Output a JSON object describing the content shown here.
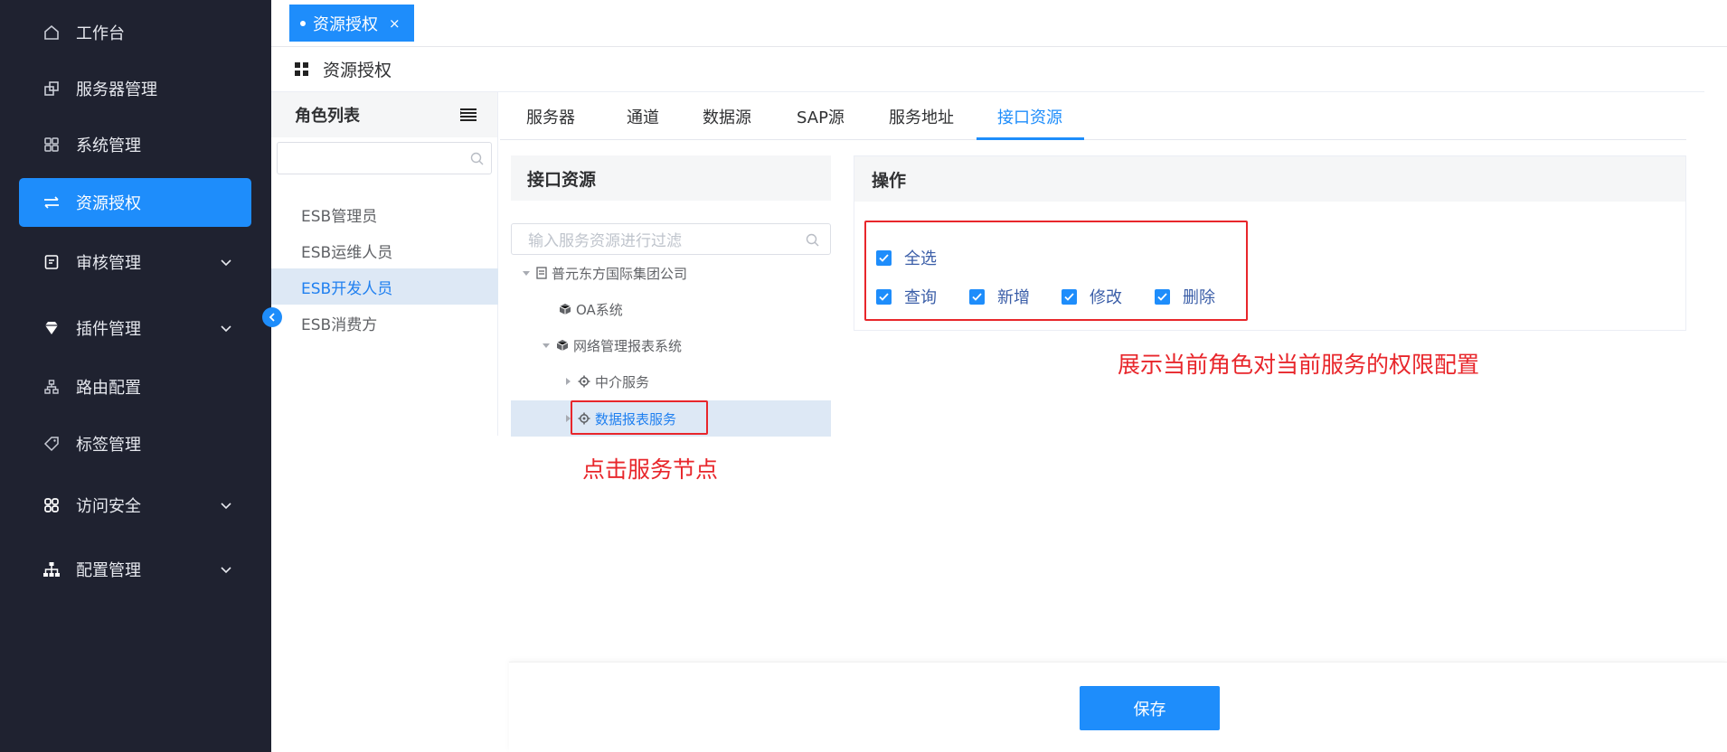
{
  "sidebar": {
    "items": [
      {
        "label": "工作台",
        "icon": "home-icon"
      },
      {
        "label": "服务器管理",
        "icon": "server-icon"
      },
      {
        "label": "系统管理",
        "icon": "grid-icon"
      },
      {
        "label": "资源授权",
        "icon": "swap-icon"
      },
      {
        "label": "审核管理",
        "icon": "audit-icon"
      },
      {
        "label": "插件管理",
        "icon": "diamond-icon"
      },
      {
        "label": "路由配置",
        "icon": "route-icon"
      },
      {
        "label": "标签管理",
        "icon": "tag-icon"
      },
      {
        "label": "访问安全",
        "icon": "security-icon"
      },
      {
        "label": "配置管理",
        "icon": "hierarchy-icon"
      }
    ]
  },
  "open_tab": {
    "label": "资源授权",
    "close": "×"
  },
  "breadcrumb": {
    "title": "资源授权"
  },
  "roles": {
    "title": "角色列表",
    "search_placeholder": "",
    "items": [
      "ESB管理员",
      "ESB运维人员",
      "ESB开发人员",
      "ESB消费方"
    ],
    "selected": "ESB开发人员"
  },
  "tabs": [
    "服务器",
    "通道",
    "数据源",
    "SAP源",
    "服务地址",
    "接口资源"
  ],
  "active_tab": "接口资源",
  "resource_panel": {
    "title": "接口资源",
    "filter_placeholder": "输入服务资源进行过滤",
    "tree": [
      {
        "label": "普元东方国际集团公司"
      },
      {
        "label": "OA系统"
      },
      {
        "label": "网络管理报表系统"
      },
      {
        "label": "中介服务"
      },
      {
        "label": "数据报表服务"
      }
    ]
  },
  "operations": {
    "title": "操作",
    "select_all": "全选",
    "perms": [
      "查询",
      "新增",
      "修改",
      "删除"
    ]
  },
  "annotations": {
    "click_node": "点击服务节点",
    "show_perms": "展示当前角色对当前服务的权限配置"
  },
  "save_label": "保存",
  "colors": {
    "accent": "#1e8dfb",
    "sidebar": "#1f2230",
    "annotation": "#e8262b",
    "selected_row": "#dde8f5"
  }
}
